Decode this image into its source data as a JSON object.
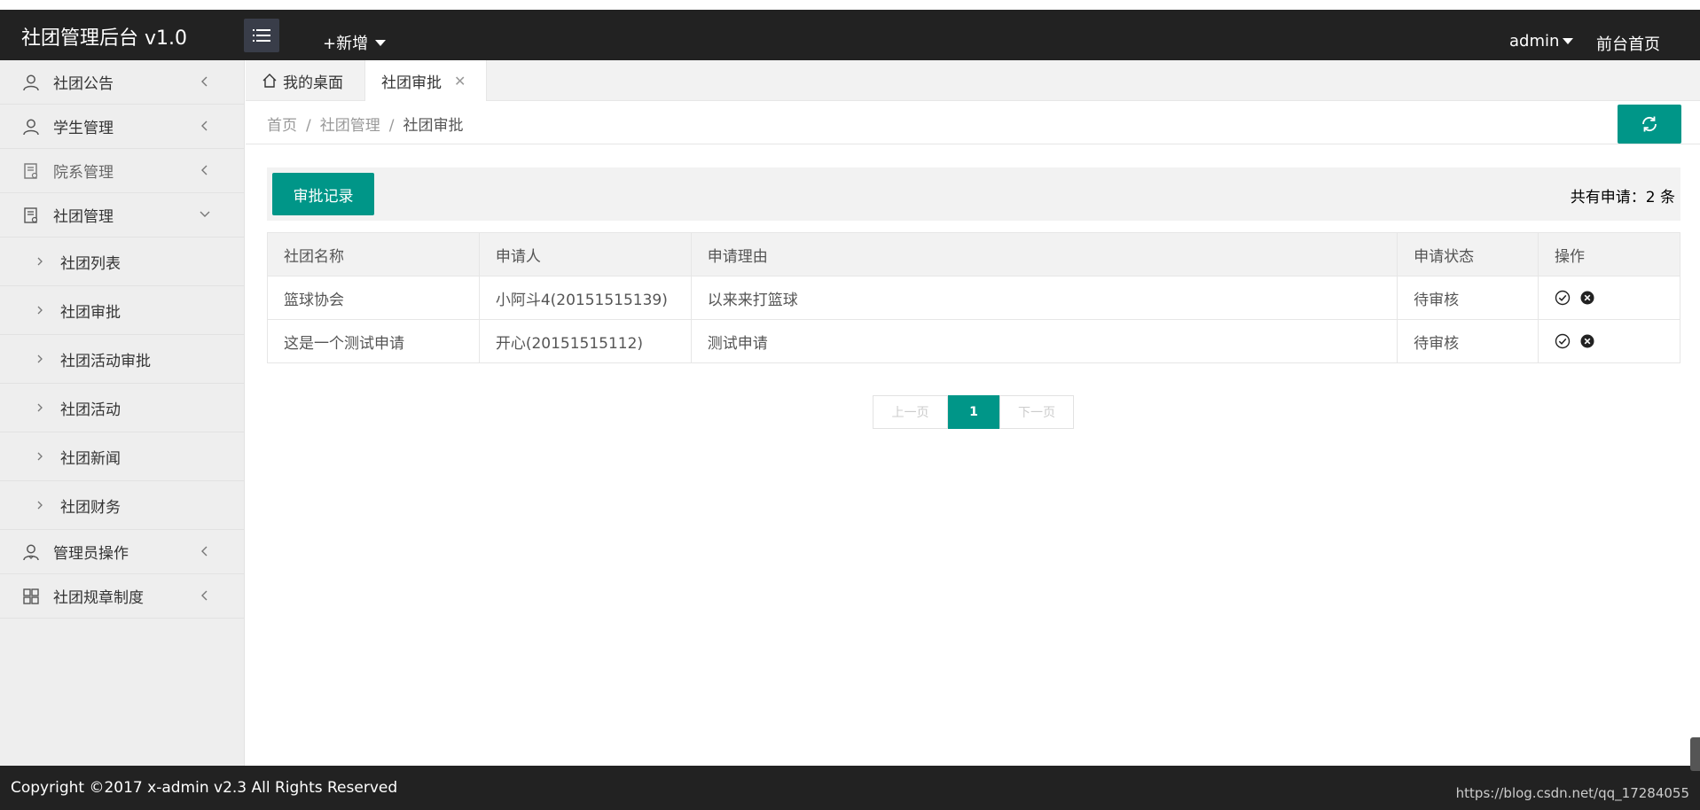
{
  "header": {
    "logo": "社团管理后台 v1.0",
    "add_new": "+新增",
    "user": "admin",
    "front_home": "前台首页"
  },
  "sidebar": {
    "items": [
      {
        "label": "社团公告",
        "icon": "user-icon"
      },
      {
        "label": "学生管理",
        "icon": "user-icon"
      },
      {
        "label": "院系管理",
        "icon": "document-icon"
      },
      {
        "label": "社团管理",
        "icon": "document-icon",
        "expanded": true
      }
    ],
    "sub_items": [
      "社团列表",
      "社团审批",
      "社团活动审批",
      "社团活动",
      "社团新闻",
      "社团财务"
    ],
    "bottom_items": [
      {
        "label": "管理员操作",
        "icon": "admin-user-icon"
      },
      {
        "label": "社团规章制度",
        "icon": "grid-icon"
      }
    ]
  },
  "tabs": {
    "home": "我的桌面",
    "active": "社团审批"
  },
  "breadcrumb": {
    "home": "首页",
    "sep": "/",
    "level1": "社团管理",
    "current": "社团审批"
  },
  "toolbar": {
    "records_button": "审批记录",
    "total": "共有申请：2 条"
  },
  "table": {
    "headers": [
      "社团名称",
      "申请人",
      "申请理由",
      "申请状态",
      "操作"
    ],
    "rows": [
      {
        "name": "篮球协会",
        "applicant": "小阿斗4(20151515139)",
        "reason": "以来来打篮球",
        "status": "待审核"
      },
      {
        "name": "这是一个测试申请",
        "applicant": "开心(20151515112)",
        "reason": "测试申请",
        "status": "待审核"
      }
    ]
  },
  "pager": {
    "prev": "上一页",
    "current": "1",
    "next": "下一页"
  },
  "footer": {
    "copyright": "Copyright ©2017 x-admin v2.3 All Rights Reserved",
    "watermark": "https://blog.csdn.net/qq_17284055"
  },
  "colors": {
    "accent": "#009688",
    "header_bg": "#222222",
    "sidebar_bg": "#eeeeee"
  }
}
